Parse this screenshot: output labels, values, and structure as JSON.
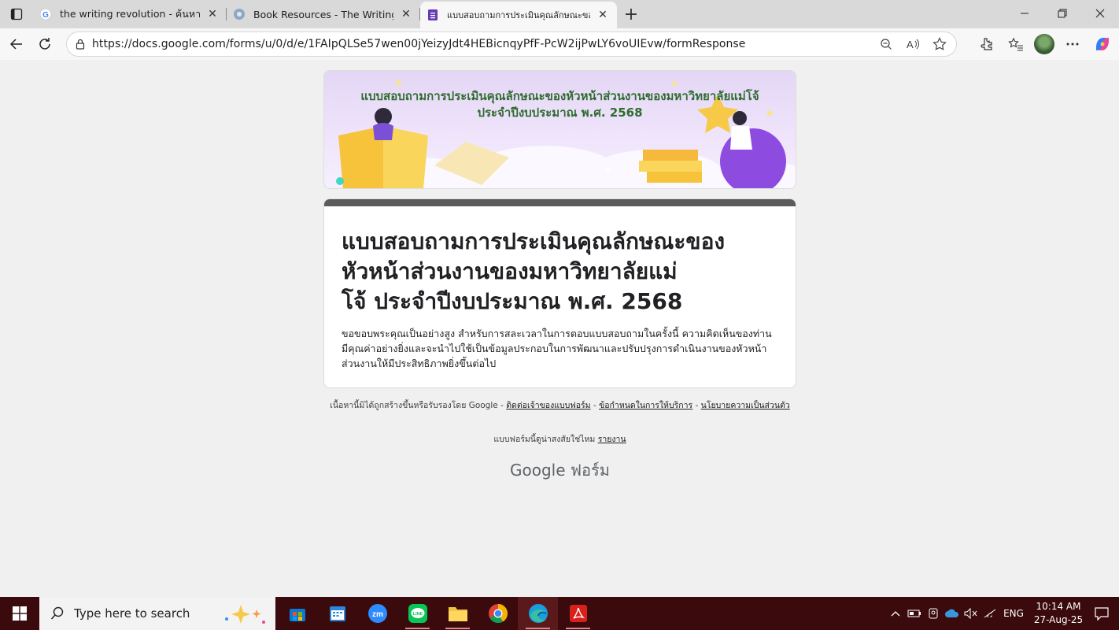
{
  "browser": {
    "tabs": [
      {
        "title": "the writing revolution - ค้นหาด้วย G",
        "active": false
      },
      {
        "title": "Book Resources - The Writing Rev",
        "active": false
      },
      {
        "title": "แบบสอบถามการประเมินคุณลักษณะขอ",
        "active": true
      }
    ],
    "url": "https://docs.google.com/forms/u/0/d/e/1FAIpQLSe57wen00jYeizyJdt4HEBicnqyPfF-PcW2ijPwLY6voUIEvw/formResponse"
  },
  "form": {
    "banner_title_line1": "แบบสอบถามการประเมินคุณลักษณะของหัวหน้าส่วนงานของมหาวิทยาลัยแม่โจ้",
    "banner_title_line2": "ประจำปีงบประมาณ พ.ศ. 2568",
    "title_line1": "แบบสอบถามการประเมินคุณลักษณะของ",
    "title_line2": "หัวหน้าส่วนงานของมหาวิทยาลัยแม่",
    "title_line3": "โจ้ ประจำปีงบประมาณ พ.ศ. 2568",
    "description_line1": "ขอขอบพระคุณเป็นอย่างสูง สำหรับการสละเวลาในการตอบแบบสอบถามในครั้งนี้ ความคิดเห็นของท่าน",
    "description_line2": "มีคุณค่าอย่างยิ่งและจะนำไปใช้เป็นข้อมูลประกอบในการพัฒนาและปรับปรุงการดำเนินงานของหัวหน้า",
    "description_line3": "ส่วนงานให้มีประสิทธิภาพยิ่งขึ้นต่อไป"
  },
  "footer": {
    "disclaimer": "เนื้อหานี้มิได้ถูกสร้างขึ้นหรือรับรองโดย Google - ",
    "contact_link": "ติดต่อเจ้าของแบบฟอร์ม",
    "sep1": " - ",
    "terms_link": "ข้อกำหนดในการให้บริการ",
    "sep2": " - ",
    "privacy_link": "นโยบายความเป็นส่วนตัว",
    "suspicious": "แบบฟอร์มนี้ดูน่าสงสัยใช่ไหม ",
    "report_link": "รายงาน",
    "brand_google": "Google",
    "brand_forms": " ฟอร์ม"
  },
  "taskbar": {
    "search_placeholder": "Type here to search",
    "language": "ENG",
    "time": "10:14 AM",
    "date": "27-Aug-25"
  },
  "colors": {
    "taskbar": "#3b0a0c",
    "card_accent": "#5b5b5b",
    "banner_title": "#2f6b2f"
  }
}
